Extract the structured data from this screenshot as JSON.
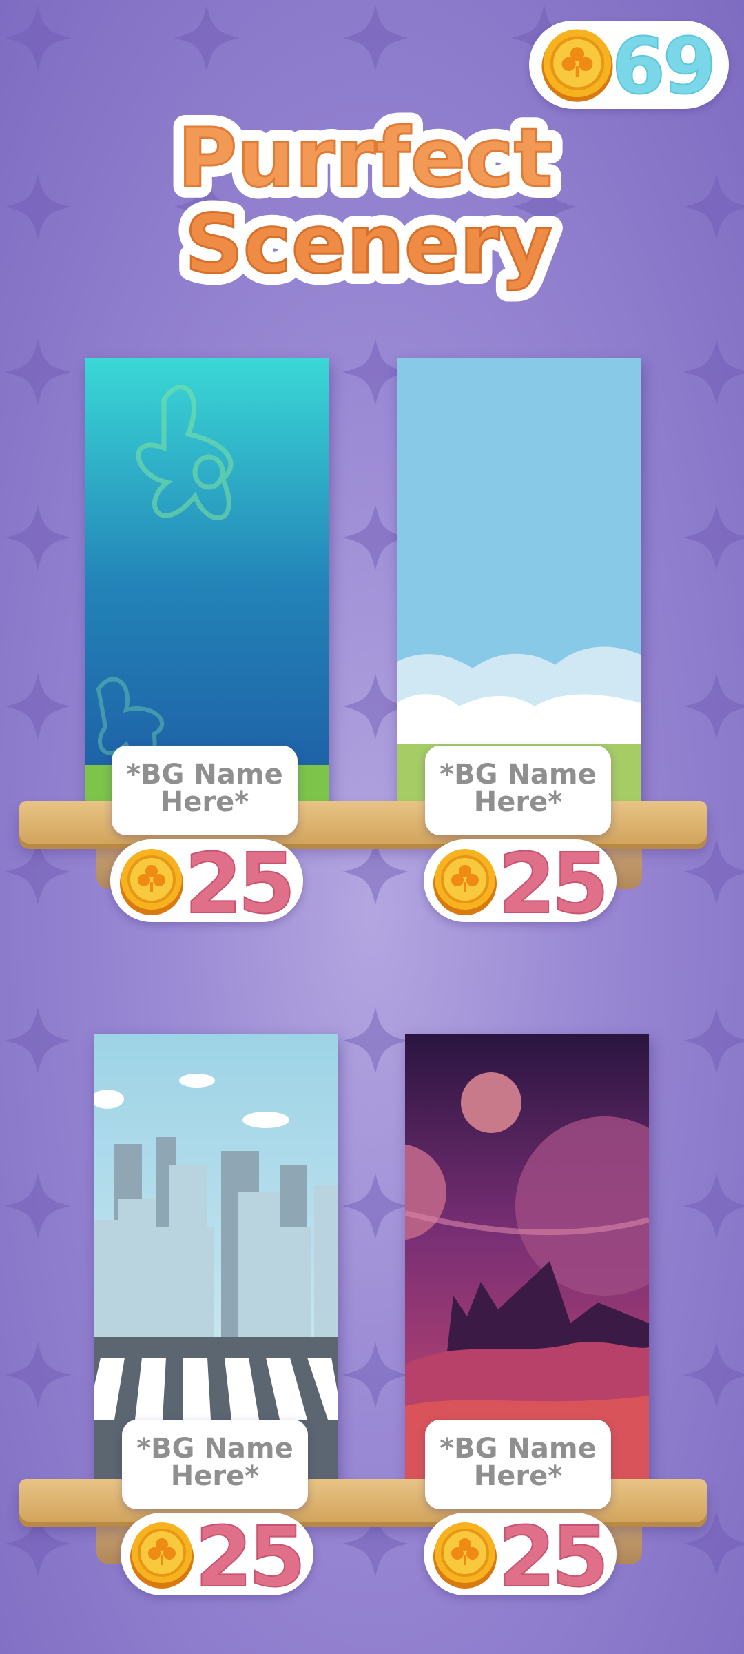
{
  "header": {
    "coin_count": "69",
    "title_line1": "Purrfect",
    "title_line2": "Scenery"
  },
  "backgrounds": [
    {
      "name": "*BG Name Here*",
      "price": "25",
      "theme": "underwater"
    },
    {
      "name": "*BG Name Here*",
      "price": "25",
      "theme": "sky"
    },
    {
      "name": "*BG Name Here*",
      "price": "25",
      "theme": "city"
    },
    {
      "name": "*BG Name Here*",
      "price": "25",
      "theme": "alien-planet"
    }
  ],
  "colors": {
    "background": "#9a89d4",
    "title_fill": "#f29a55",
    "coin_count": "#7ad7e8",
    "price_text": "#e0708a",
    "shelf": "#e0b874"
  },
  "icons": [
    "clover-coin-icon",
    "sparkle-star-pattern"
  ]
}
